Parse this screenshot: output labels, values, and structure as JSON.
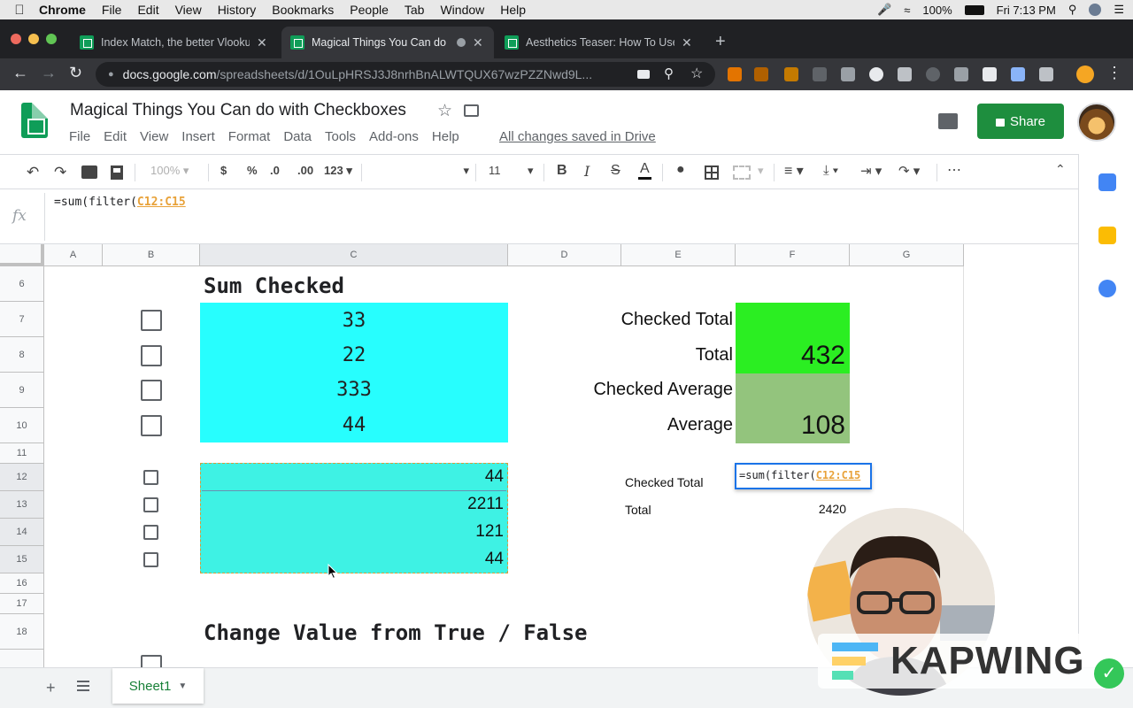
{
  "mac_menubar": {
    "items": [
      "Chrome",
      "File",
      "Edit",
      "View",
      "History",
      "Bookmarks",
      "People",
      "Tab",
      "Window",
      "Help"
    ],
    "battery": "100%",
    "clock": "Fri 7:13 PM"
  },
  "browser": {
    "tabs": [
      {
        "title": "Index Match, the better Vlooku",
        "active": false
      },
      {
        "title": "Magical Things You Can do",
        "active": true
      },
      {
        "title": "Aesthetics Teaser: How To Use",
        "active": false
      }
    ],
    "url_host": "docs.google.com",
    "url_path": "/spreadsheets/d/1OuLpHRSJ3J8nrhBnALWTQUX67wzPZZNwd9L..."
  },
  "doc": {
    "title": "Magical Things You Can do with Checkboxes",
    "menu": [
      "File",
      "Edit",
      "View",
      "Insert",
      "Format",
      "Data",
      "Tools",
      "Add-ons",
      "Help"
    ],
    "save_status": "All changes saved in Drive",
    "share_label": "Share"
  },
  "toolbar": {
    "zoom": "100%",
    "currency": "$",
    "percent": "%",
    "decrease_decimal": ".0",
    "increase_decimal": ".00",
    "more_formats": "123",
    "font_size": "11",
    "bold": "B",
    "italic": "I",
    "strike": "S",
    "text_color": "A"
  },
  "formula_bar": {
    "fx": "fx",
    "prefix": "=sum(filter(",
    "range": "C12:C15"
  },
  "grid": {
    "columns": [
      "A",
      "B",
      "C",
      "D",
      "E",
      "F",
      "G"
    ],
    "rows": [
      "6",
      "7",
      "8",
      "9",
      "10",
      "11",
      "12",
      "13",
      "14",
      "15",
      "16",
      "17",
      "18"
    ],
    "section1_title": "Sum Checked",
    "section2_title": "Change Value from True / False",
    "big_values": [
      "33",
      "22",
      "333",
      "44"
    ],
    "small_values": [
      "44",
      "2211",
      "121",
      "44"
    ],
    "summary_labels": [
      "Checked Total",
      "Total",
      "Checked Average",
      "Average"
    ],
    "summary_values": [
      "",
      "432",
      "",
      "108"
    ],
    "small_labels": [
      "Checked Total",
      "Total"
    ],
    "edit_cell_prefix": "=sum(filter(",
    "edit_cell_range": "C12:C15",
    "small_total_value": "2420"
  },
  "bottom": {
    "sheet_name": "Sheet1"
  },
  "watermark": {
    "text": "KAPWING"
  },
  "colors": {
    "cyan_fill": "#27fefe",
    "teal_fill": "#3ef2e4",
    "green_fill": "#2bee22",
    "sage_fill": "#93c47d",
    "share_green": "#1e8e3e"
  }
}
